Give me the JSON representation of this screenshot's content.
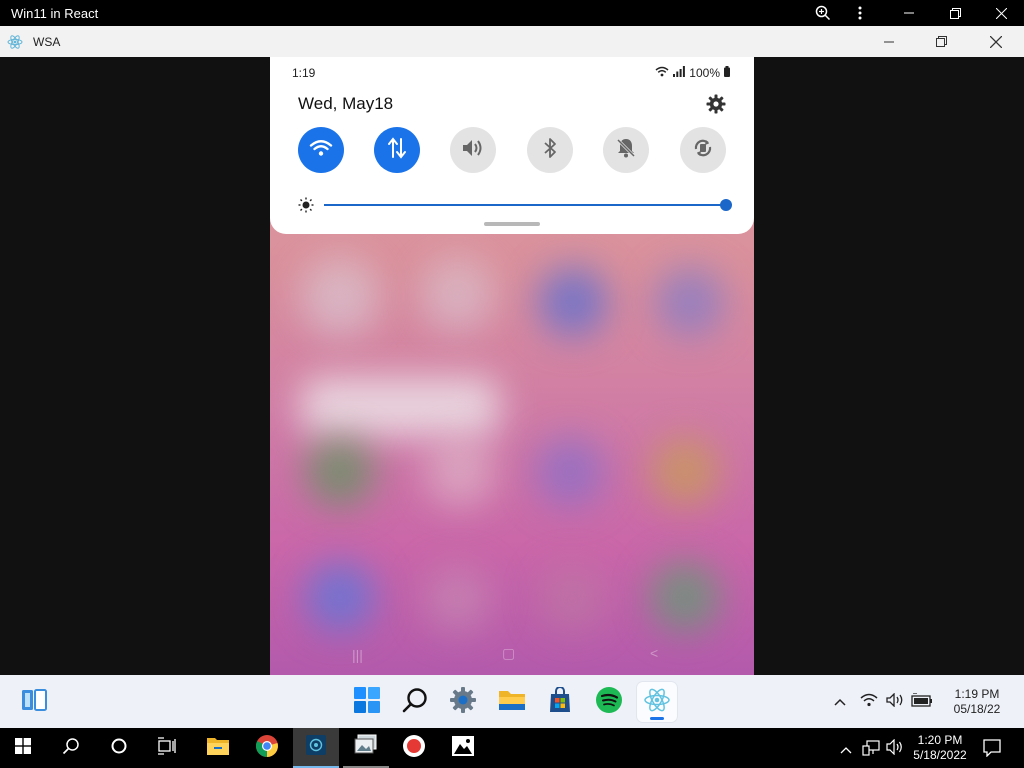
{
  "host_window": {
    "title": "Win11 in React"
  },
  "wsa_window": {
    "title": "WSA"
  },
  "android": {
    "status_time": "1:19",
    "battery": "100%",
    "date": "Wed, May18",
    "quick_settings": [
      {
        "name": "wifi",
        "on": true
      },
      {
        "name": "mobile-data",
        "on": true
      },
      {
        "name": "sound",
        "on": false
      },
      {
        "name": "bluetooth",
        "on": false
      },
      {
        "name": "do-not-disturb",
        "on": false
      },
      {
        "name": "auto-rotate",
        "on": false
      }
    ],
    "brightness": 1.0,
    "accent_color": "#1a73e8"
  },
  "win11_taskbar": {
    "apps": [
      "widgets",
      "start",
      "search",
      "settings",
      "file-explorer",
      "store",
      "spotify",
      "wsa"
    ],
    "time": "1:19 PM",
    "date": "05/18/22"
  },
  "win10_taskbar": {
    "time": "1:20 PM",
    "date": "5/18/2022"
  }
}
